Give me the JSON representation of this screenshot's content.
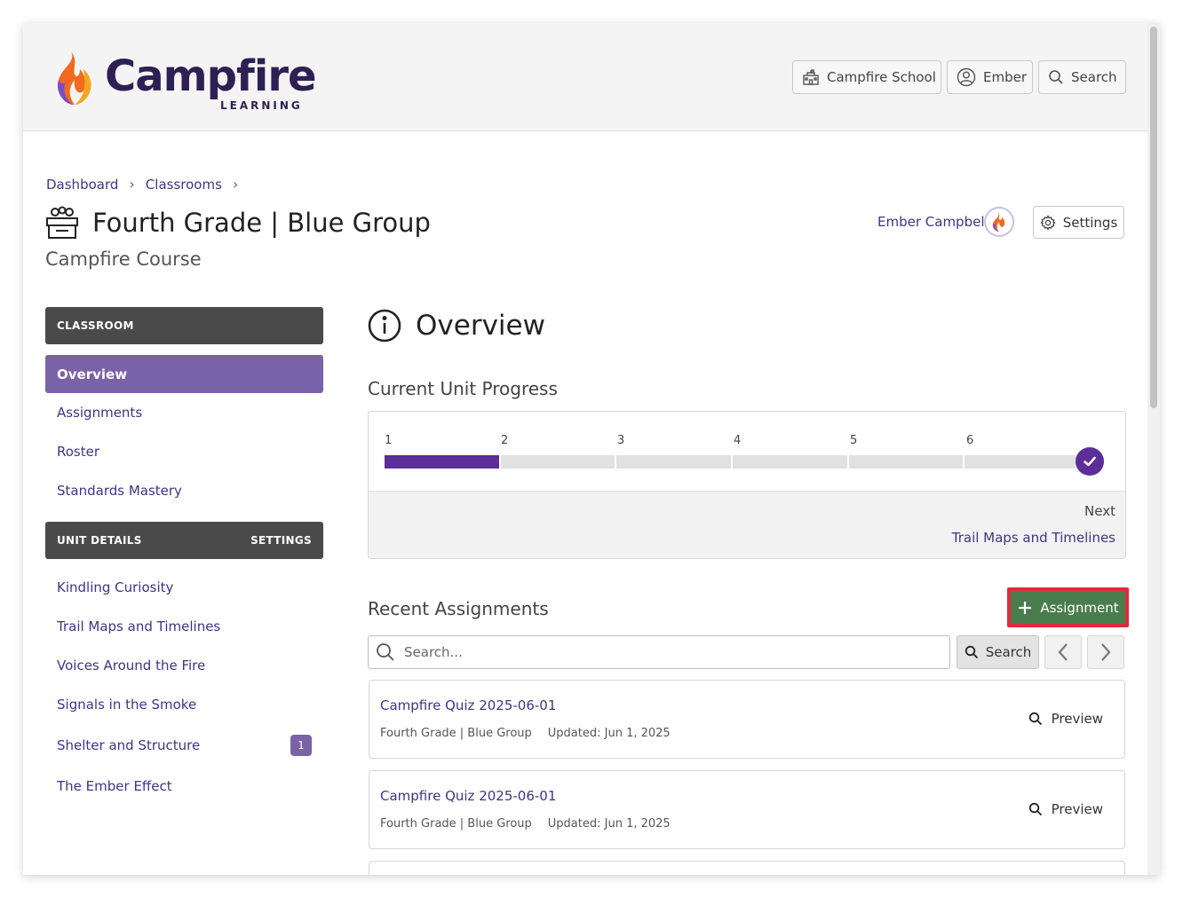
{
  "header": {
    "logo_word": "Campfire",
    "logo_sub": "LEARNING",
    "school_button": "Campfire School",
    "user_button": "Ember",
    "search_button": "Search"
  },
  "breadcrumb": [
    "Dashboard",
    "Classrooms"
  ],
  "page": {
    "title": "Fourth Grade | Blue Group",
    "subtitle": "Campfire Course",
    "user_name": "Ember Campbell",
    "settings_label": "Settings"
  },
  "sidebar": {
    "classroom_header": "CLASSROOM",
    "active_item": "Overview",
    "items": [
      "Assignments",
      "Roster",
      "Standards Mastery"
    ],
    "unit_header": "UNIT DETAILS",
    "unit_settings": "SETTINGS",
    "units": [
      {
        "label": "Kindling Curiosity",
        "badge": ""
      },
      {
        "label": "Trail Maps and Timelines",
        "badge": ""
      },
      {
        "label": "Voices Around the Fire",
        "badge": ""
      },
      {
        "label": "Signals in the Smoke",
        "badge": ""
      },
      {
        "label": "Shelter and Structure",
        "badge": "1"
      },
      {
        "label": "The Ember Effect",
        "badge": ""
      }
    ]
  },
  "main": {
    "overview_title": "Overview",
    "progress_heading": "Current Unit Progress",
    "progress": {
      "steps": [
        "1",
        "2",
        "3",
        "4",
        "5",
        "6"
      ],
      "completed_segments": 1,
      "total_segments": 6,
      "next_label": "Next",
      "next_unit": "Trail Maps and Timelines"
    },
    "recent_heading": "Recent Assignments",
    "add_assignment_label": "Assignment",
    "search_placeholder": "Search...",
    "search_button": "Search",
    "assignments": [
      {
        "title": "Campfire Quiz 2025-06-01",
        "group": "Fourth Grade | Blue Group",
        "updated": "Updated: Jun 1, 2025",
        "action": "Preview"
      },
      {
        "title": "Campfire Quiz 2025-06-01",
        "group": "Fourth Grade | Blue Group",
        "updated": "Updated: Jun 1, 2025",
        "action": "Preview"
      }
    ]
  },
  "colors": {
    "brand_purple": "#3f3585",
    "sidebar_active": "#7a62a8",
    "progress_fill": "#5b2e98",
    "assign_button": "#4a7d4d",
    "highlight_border": "#e02a3c"
  }
}
